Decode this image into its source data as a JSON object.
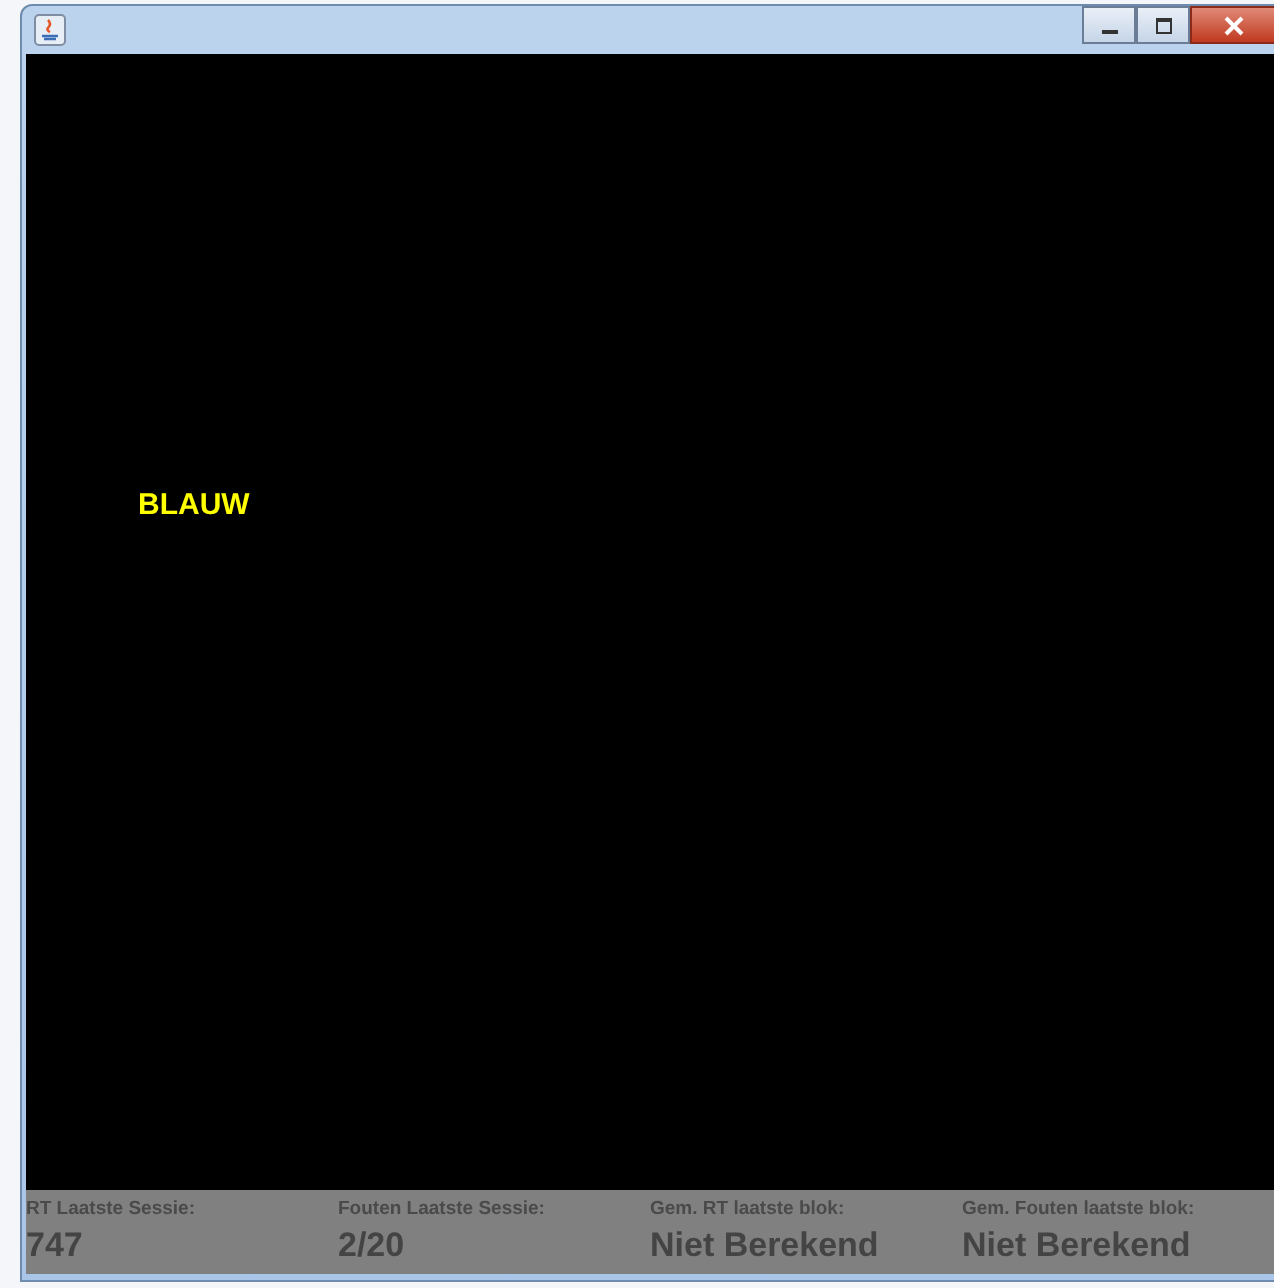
{
  "stimulus": {
    "word": "BLAUW"
  },
  "stats": [
    {
      "label": "RT Laatste Sessie:",
      "value": "747"
    },
    {
      "label": "Fouten Laatste Sessie:",
      "value": "2/20"
    },
    {
      "label": "Gem. RT laatste blok:",
      "value": "Niet Berekend"
    },
    {
      "label": "Gem. Fouten laatste blok:",
      "value": "Niet Berekend"
    }
  ]
}
